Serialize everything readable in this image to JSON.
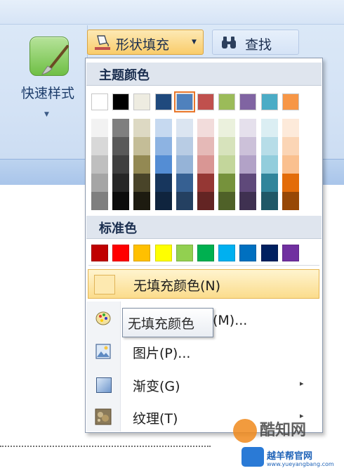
{
  "ribbon": {
    "quick_style_label": "快速样式",
    "shape_fill_label": "形状填充",
    "find_label": "查找"
  },
  "menu": {
    "theme_colors_title": "主题颜色",
    "standard_colors_title": "标准色",
    "theme_base": [
      "#ffffff",
      "#000000",
      "#eeece1",
      "#1f497d",
      "#4f81bd",
      "#c0504d",
      "#9bbb59",
      "#8064a2",
      "#4bacc6",
      "#f79646"
    ],
    "theme_selected_index": 4,
    "theme_tints": [
      [
        "#f2f2f2",
        "#d8d8d8",
        "#bfbfbf",
        "#a5a5a5",
        "#7f7f7f"
      ],
      [
        "#7f7f7f",
        "#595959",
        "#3f3f3f",
        "#262626",
        "#0c0c0c"
      ],
      [
        "#ddd9c3",
        "#c4bd97",
        "#938953",
        "#494429",
        "#1d1b10"
      ],
      [
        "#c6d9f0",
        "#8db3e2",
        "#548dd4",
        "#17365d",
        "#0f243e"
      ],
      [
        "#dbe5f1",
        "#b8cce4",
        "#95b3d7",
        "#366092",
        "#244061"
      ],
      [
        "#f2dcdb",
        "#e5b9b7",
        "#d99694",
        "#953734",
        "#632423"
      ],
      [
        "#ebf1dd",
        "#d7e3bc",
        "#c3d69b",
        "#76923c",
        "#4f6128"
      ],
      [
        "#e5e0ec",
        "#ccc1d9",
        "#b2a2c7",
        "#5f497a",
        "#3f3151"
      ],
      [
        "#dbeef3",
        "#b7dde8",
        "#92cddc",
        "#31859b",
        "#205867"
      ],
      [
        "#fdeada",
        "#fbd5b5",
        "#fac08f",
        "#e36c09",
        "#974806"
      ]
    ],
    "standard_colors": [
      "#c00000",
      "#ff0000",
      "#ffc000",
      "#ffff00",
      "#92d050",
      "#00b050",
      "#00b0f0",
      "#0070c0",
      "#002060",
      "#7030a0"
    ],
    "items": [
      {
        "label": "无填充颜色(N)",
        "icon": "no-fill-icon"
      },
      {
        "label": "其他填充颜色(M)...",
        "icon": "palette-icon"
      },
      {
        "label": "图片(P)...",
        "icon": "picture-icon"
      },
      {
        "label": "渐变(G)",
        "icon": "gradient-icon",
        "submenu": "▸"
      },
      {
        "label": "纹理(T)",
        "icon": "texture-icon",
        "submenu": "▸"
      }
    ]
  },
  "tooltip": {
    "text": "无填充颜色"
  },
  "watermark": {
    "brand": "酷知网",
    "site_name": "越羊帮官网",
    "site_url": "www.yueyangbang.com"
  }
}
